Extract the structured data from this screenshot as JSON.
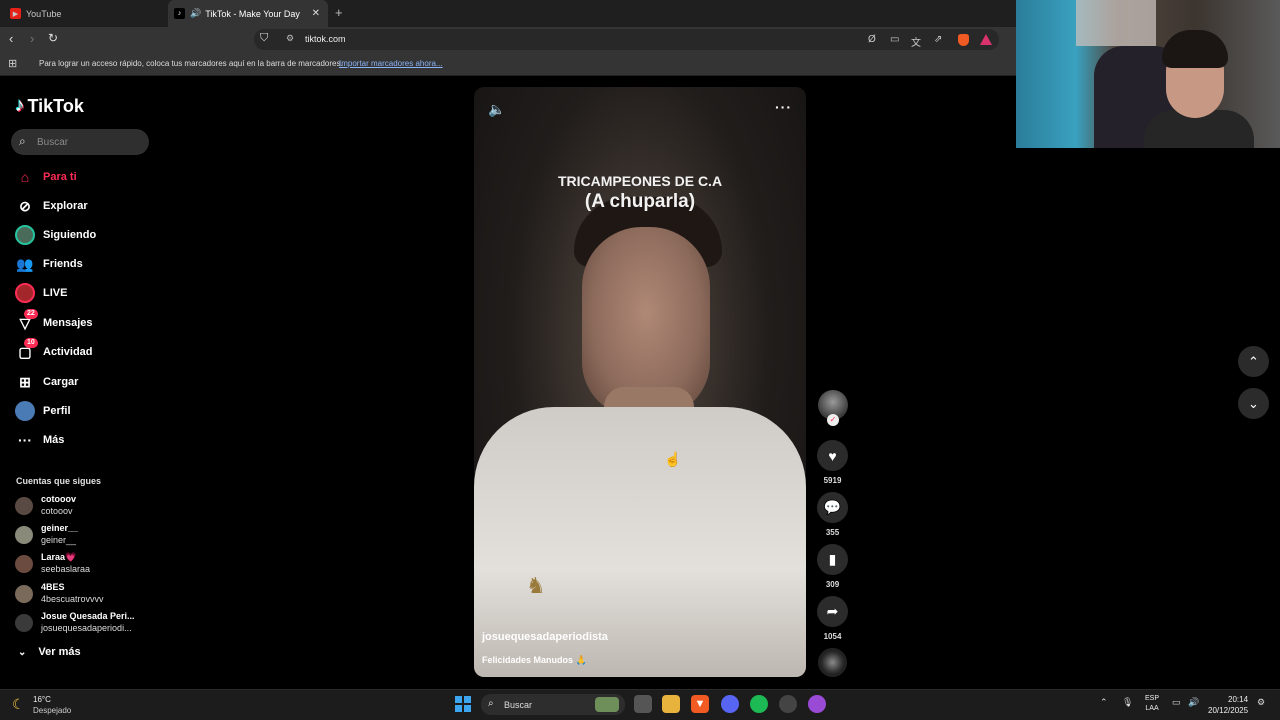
{
  "browser": {
    "tabs": [
      {
        "title": "YouTube",
        "active": false
      },
      {
        "title": "TikTok - Make Your Day",
        "active": true
      }
    ],
    "url": "tiktok.com",
    "bookmarks_bar": {
      "message": "Para lograr un acceso rápido, coloca tus marcadores aquí en la barra de marcadores.",
      "import_link": "Importar marcadores ahora..."
    }
  },
  "tiktok": {
    "logo": "TikTok",
    "search_placeholder": "Buscar",
    "nav": [
      {
        "label": "Para ti",
        "icon": "home-icon",
        "active": true
      },
      {
        "label": "Explorar",
        "icon": "compass-icon"
      },
      {
        "label": "Siguiendo",
        "icon": "following-avatar"
      },
      {
        "label": "Friends",
        "icon": "friends-icon"
      },
      {
        "label": "LIVE",
        "icon": "live-icon"
      },
      {
        "label": "Mensajes",
        "icon": "messages-icon",
        "badge": "22"
      },
      {
        "label": "Actividad",
        "icon": "activity-icon",
        "badge": "10"
      },
      {
        "label": "Cargar",
        "icon": "upload-icon"
      },
      {
        "label": "Perfil",
        "icon": "profile-avatar"
      },
      {
        "label": "Más",
        "icon": "more-icon"
      }
    ],
    "following_title": "Cuentas que sigues",
    "following": [
      {
        "name": "cotooov",
        "handle": "cotooov"
      },
      {
        "name": "geiner__",
        "handle": "geiner__"
      },
      {
        "name": "Laraa💗",
        "handle": "seebaslaraa"
      },
      {
        "name": "4BES",
        "handle": "4bescuatrovvvv"
      },
      {
        "name": "Josue Quesada Peri...",
        "handle": "josuequesadaperiodi..."
      }
    ],
    "see_more": "Ver más",
    "video": {
      "caption_line1": "TRICAMPEONES DE C.A",
      "caption_line2": "(A chuparla)",
      "author": "josuequesadaperiodista",
      "description": "Felicidades Manudos 🙏"
    },
    "actions": {
      "likes": "5919",
      "comments": "355",
      "saves": "309",
      "shares": "1054"
    }
  },
  "taskbar": {
    "temperature": "16°C",
    "condition": "Despejado",
    "search": "Buscar",
    "lang_line1": "ESP",
    "lang_line2": "LAA",
    "time": "20:14",
    "date": "20/12/2025"
  }
}
